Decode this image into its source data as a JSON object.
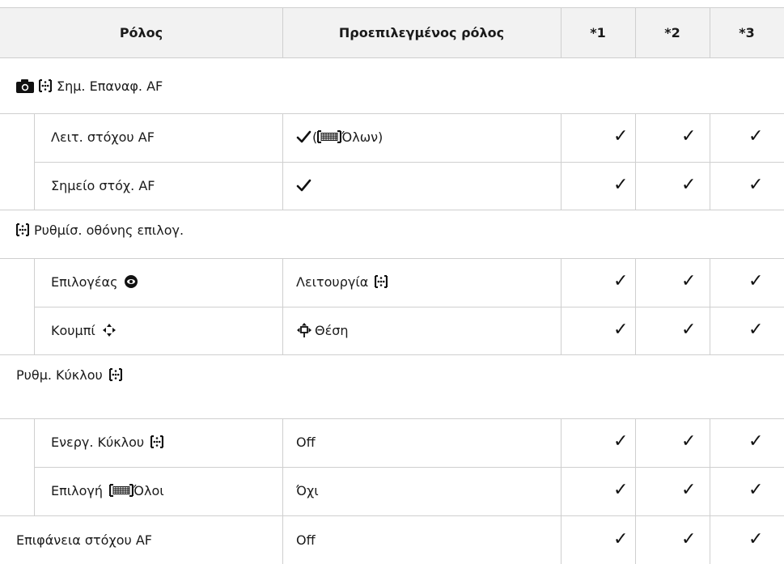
{
  "header": {
    "col_role": "Ρόλος",
    "col_default": "Προεπιλεγμένος ρόλος",
    "col_1": "*1",
    "col_2": "*2",
    "col_3": "*3"
  },
  "sections": [
    {
      "title": "Σημ. Επαναφ. AF",
      "title_icons": [
        "camera-icon",
        "af-target-icon"
      ],
      "rows": [
        {
          "label": "Λειτ. στόχου AF",
          "default_prefix": "(",
          "default_text": "Όλων)",
          "default_icons": [
            "check-icon",
            "all-targets-icon"
          ],
          "c1": "✓",
          "c2": "✓",
          "c3": "✓"
        },
        {
          "label": "Σημείο στόχ. AF",
          "default_text": "",
          "default_icons": [
            "check-icon"
          ],
          "c1": "✓",
          "c2": "✓",
          "c3": "✓"
        }
      ]
    },
    {
      "title": "Ρυθμίσ. οθόνης επιλογ.",
      "title_icons": [
        "af-target-icon"
      ],
      "rows": [
        {
          "label": "Επιλογέας",
          "label_icons": [
            "dial-icon"
          ],
          "default_text": "Λειτουργία",
          "default_icons": [
            "af-target-icon"
          ],
          "c1": "✓",
          "c2": "✓",
          "c3": "✓"
        },
        {
          "label": "Κουμπί",
          "label_icons": [
            "arrow-pad-icon"
          ],
          "default_text": "Θέση",
          "default_icons": [
            "arrow-pad-position-icon"
          ],
          "c1": "✓",
          "c2": "✓",
          "c3": "✓"
        }
      ]
    },
    {
      "title": "Ρυθμ. Κύκλου",
      "title_icons": [
        "af-target-icon"
      ],
      "rows": [
        {
          "label": "Ενεργ. Κύκλου",
          "label_icons": [
            "af-target-icon"
          ],
          "default_text": "Off",
          "c1": "✓",
          "c2": "✓",
          "c3": "✓"
        },
        {
          "label": "Επιλογή",
          "label_suffix": "Όλοι",
          "label_icons": [
            "all-targets-icon"
          ],
          "default_text": "Όχι",
          "c1": "✓",
          "c2": "✓",
          "c3": "✓"
        }
      ]
    }
  ],
  "last_row": {
    "label": "Επιφάνεια στόχου AF",
    "default_text": "Off",
    "c1": "✓",
    "c2": "✓",
    "c3": "✓"
  }
}
